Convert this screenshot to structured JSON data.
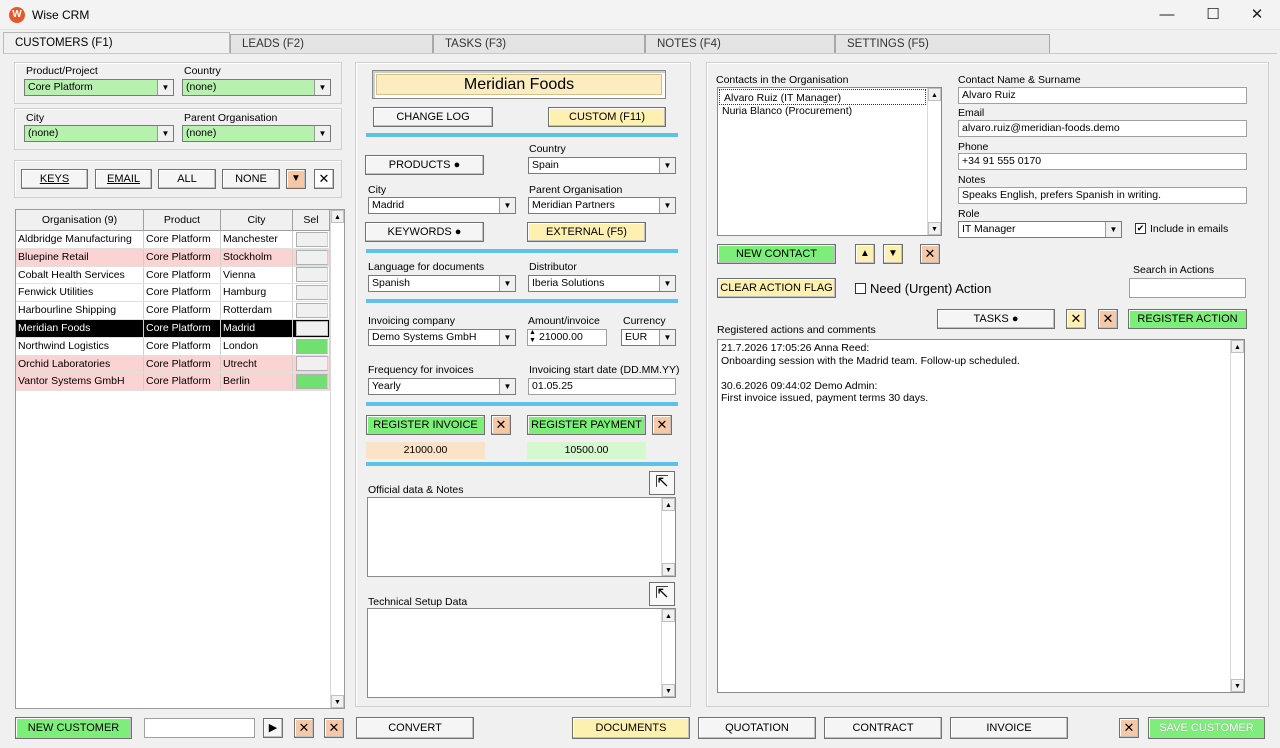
{
  "window": {
    "title": "Wise CRM",
    "icon": "wise-crm-logo-icon"
  },
  "tabs": [
    {
      "label": "CUSTOMERS (F1)"
    },
    {
      "label": "LEADS (F2)"
    },
    {
      "label": "TASKS (F3)"
    },
    {
      "label": "NOTES (F4)"
    },
    {
      "label": "SETTINGS (F5)"
    }
  ],
  "filters": {
    "product_label": "Product/Project",
    "product_value": "Core Platform",
    "country_label": "Country",
    "country_value": "(none)",
    "city_label": "City",
    "city_value": "(none)",
    "parent_label": "Parent Organisation",
    "parent_value": "(none)"
  },
  "quick_buttons": {
    "keys": "KEYS",
    "email": "EMAIL",
    "all": "ALL",
    "none": "NONE"
  },
  "grid": {
    "headers": [
      "Organisation (9)",
      "Product",
      "City",
      "Sel"
    ],
    "rows": [
      {
        "org": "Aldbridge Manufacturing",
        "product": "Core Platform",
        "city": "Manchester",
        "style": "white",
        "sel": false
      },
      {
        "org": "Bluepine Retail",
        "product": "Core Platform",
        "city": "Stockholm",
        "style": "pink",
        "sel": false
      },
      {
        "org": "Cobalt Health Services",
        "product": "Core Platform",
        "city": "Vienna",
        "style": "white",
        "sel": false
      },
      {
        "org": "Fenwick Utilities",
        "product": "Core Platform",
        "city": "Hamburg",
        "style": "white",
        "sel": false
      },
      {
        "org": "Harbourline Shipping",
        "product": "Core Platform",
        "city": "Rotterdam",
        "style": "white",
        "sel": false
      },
      {
        "org": "Meridian Foods",
        "product": "Core Platform",
        "city": "Madrid",
        "style": "pink",
        "sel": false,
        "active": true
      },
      {
        "org": "Northwind Logistics",
        "product": "Core Platform",
        "city": "London",
        "style": "white",
        "sel": true
      },
      {
        "org": "Orchid Laboratories",
        "product": "Core Platform",
        "city": "Utrecht",
        "style": "pink",
        "sel": false
      },
      {
        "org": "Vantor Systems GmbH",
        "product": "Core Platform",
        "city": "Berlin",
        "style": "pink",
        "sel": true
      }
    ]
  },
  "customer": {
    "name": "Meridian Foods",
    "change_log": "CHANGE LOG",
    "custom": "CUSTOM (F11)",
    "products": "PRODUCTS",
    "country_label": "Country",
    "country": "Spain",
    "city_label": "City",
    "city": "Madrid",
    "parent_label": "Parent Organisation",
    "parent": "Meridian Partners",
    "keywords": "KEYWORDS",
    "external": "EXTERNAL (F5)",
    "language_label": "Language for documents",
    "language": "Spanish",
    "distributor_label": "Distributor",
    "distributor": "Iberia Solutions",
    "invoicing_company_label": "Invoicing company",
    "invoicing_company": "Demo Systems GmbH",
    "amount_label": "Amount/invoice",
    "amount": "21000.00",
    "currency_label": "Currency",
    "currency": "EUR",
    "frequency_label": "Frequency for invoices",
    "frequency": "Yearly",
    "start_label": "Invoicing start date (DD.MM.YY)",
    "start": "01.05.25",
    "register_invoice": "REGISTER INVOICE",
    "register_payment": "REGISTER PAYMENT",
    "invoice_total": "21000.00",
    "payment_total": "10500.00",
    "official_label": "Official data & Notes",
    "technical_label": "Technical Setup Data"
  },
  "contacts": {
    "list_label": "Contacts in the Organisation",
    "items": [
      "Alvaro Ruiz  (IT Manager)",
      "Nuria Blanco  (Procurement)"
    ],
    "name_label": "Contact Name & Surname",
    "name": "Alvaro Ruiz",
    "email_label": "Email",
    "email": "alvaro.ruiz@meridian-foods.demo",
    "phone_label": "Phone",
    "phone": "+34 91 555 0170",
    "notes_label": "Notes",
    "notes": "Speaks English, prefers Spanish in writing.",
    "role_label": "Role",
    "role": "IT Manager",
    "include_label": "Include in emails",
    "new_contact": "NEW CONTACT"
  },
  "actions": {
    "clear_flag": "CLEAR ACTION FLAG",
    "need_label": "Need (Urgent) Action",
    "search_label": "Search in Actions",
    "registered_label": "Registered actions and comments",
    "tasks": "TASKS",
    "register_action": "REGISTER ACTION",
    "log": [
      "21.7.2026 17:05:26  Anna Reed:",
      "Onboarding session with the Madrid team. Follow-up scheduled.",
      "",
      "30.6.2026 09:44:02  Demo Admin:",
      "First invoice issued, payment terms 30 days."
    ]
  },
  "bottom": {
    "new_customer": "NEW CUSTOMER",
    "convert": "CONVERT",
    "documents": "DOCUMENTS",
    "quotation": "QUOTATION",
    "contract": "CONTRACT",
    "invoice": "INVOICE",
    "save_customer": "SAVE CUSTOMER"
  },
  "colors": {
    "accent_separator": "#5fc0e8",
    "green_button": "#7eee7a",
    "yellow_button": "#fdf0b0",
    "pink_row": "#fbd3d3",
    "orange_button": "#f5c9a8"
  }
}
